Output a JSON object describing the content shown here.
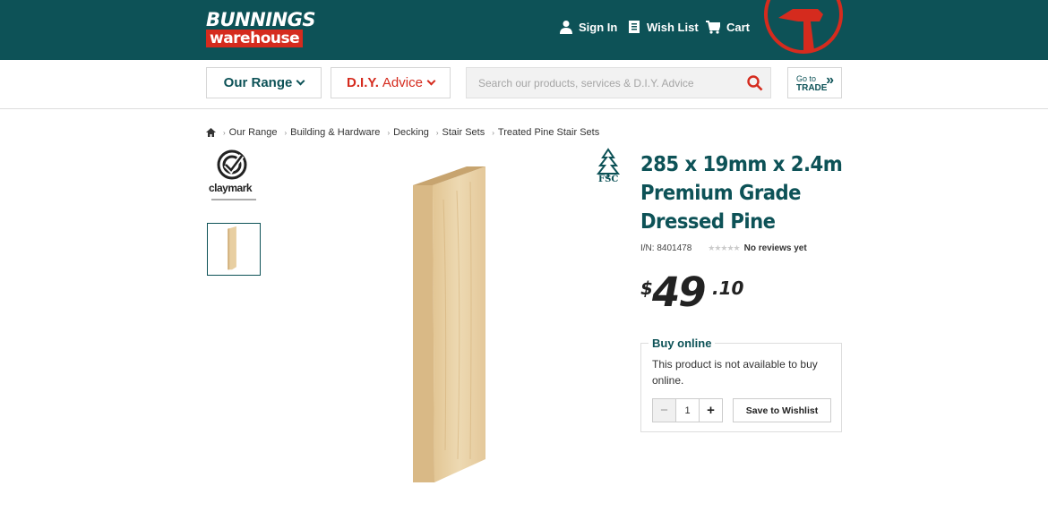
{
  "header": {
    "logo_line1": "BUNNINGS",
    "logo_line2": "warehouse",
    "sign_in": "Sign In",
    "wish_list": "Wish List",
    "cart": "Cart"
  },
  "subnav": {
    "our_range": "Our Range",
    "diy_main": "D.I.Y.",
    "diy_sub": "Advice",
    "search_placeholder": "Search our products, services & D.I.Y. Advice",
    "trade_line1": "Go to",
    "trade_line2": "TRADE"
  },
  "breadcrumb": [
    "Our Range",
    "Building & Hardware",
    "Decking",
    "Stair Sets",
    "Treated Pine Stair Sets"
  ],
  "brand": {
    "name": "claymark"
  },
  "product": {
    "title": "285 x 19mm x 2.4m Premium Grade Dressed Pine",
    "item_number": "I/N: 8401478",
    "rating_text": "No reviews yet",
    "rating": 0,
    "price_currency": "$",
    "price_main": "49",
    "price_cents": ".10",
    "fsc_label": "FSC"
  },
  "buy_online": {
    "legend": "Buy online",
    "message": "This product is not available to buy online.",
    "quantity": "1",
    "wishlist_button": "Save to Wishlist"
  },
  "colors": {
    "brand_green": "#0d5257",
    "brand_red": "#d52b1e"
  }
}
